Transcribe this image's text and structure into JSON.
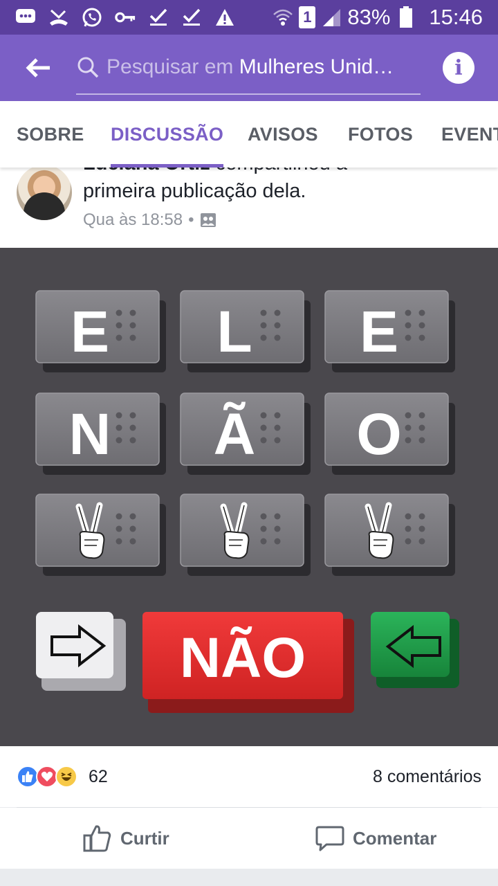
{
  "status_bar": {
    "battery": "83%",
    "time": "15:46",
    "sim_slot": "1",
    "icons": [
      "chat-icon",
      "missed-call-icon",
      "whatsapp-icon",
      "key-icon",
      "check-icon",
      "check-icon",
      "warning-icon",
      "wifi-icon",
      "signal-icon",
      "battery-icon"
    ]
  },
  "app_bar": {
    "search_prefix": "Pesquisar em ",
    "search_group": "Mulheres Unid…",
    "icons": [
      "back-arrow-icon",
      "search-icon",
      "info-icon"
    ]
  },
  "tabs": [
    {
      "label": "SOBRE",
      "active": false
    },
    {
      "label": "DISCUSSÃO",
      "active": true
    },
    {
      "label": "AVISOS",
      "active": false
    },
    {
      "label": "FOTOS",
      "active": false
    },
    {
      "label": "EVENT",
      "active": false
    }
  ],
  "post": {
    "author": "Luciana Ortiz",
    "action": " compartilhou a",
    "action_line2": "primeira publicação dela.",
    "timestamp": "Qua às 18:58",
    "separator": "•",
    "privacy_icon": "group-icon",
    "image": {
      "keys_row1": [
        "E",
        "L",
        "E"
      ],
      "keys_row2": [
        "N",
        "Ã",
        "O"
      ],
      "keys_row3_icon": "peace-hand-icon",
      "bottom_button": "NÃO",
      "bottom_icons": [
        "arrow-right-icon",
        "arrow-left-icon"
      ]
    }
  },
  "engagement": {
    "reaction_icons": [
      "like-icon",
      "love-icon",
      "haha-icon"
    ],
    "reaction_count": "62",
    "comments": "8 comentários"
  },
  "actions": {
    "like_label": "Curtir",
    "comment_label": "Comentar"
  },
  "colors": {
    "status_bar": "#5b3f9e",
    "app_bar": "#7b5fc6",
    "accent": "#7b5fc6",
    "like": "#3b82f6",
    "love": "#ef4d5f",
    "haha": "#f7c948",
    "nao_button": "#e32f2f",
    "green_button": "#1f9a45"
  }
}
